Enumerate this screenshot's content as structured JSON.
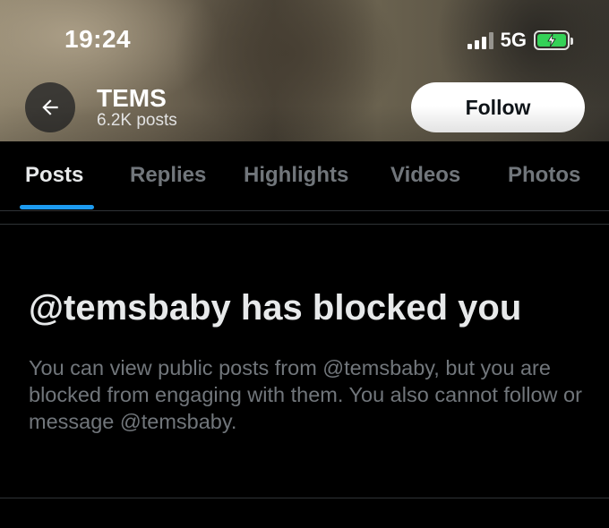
{
  "status_bar": {
    "time": "19:24",
    "network": "5G",
    "icons": [
      "signal-icon",
      "battery-charging-icon"
    ]
  },
  "profile": {
    "name": "TEMS",
    "posts_count": "6.2K posts",
    "follow_label": "Follow",
    "back_icon": "arrow-left-icon"
  },
  "tabs": [
    {
      "label": "Posts",
      "active": true
    },
    {
      "label": "Replies",
      "active": false
    },
    {
      "label": "Highlights",
      "active": false
    },
    {
      "label": "Videos",
      "active": false
    },
    {
      "label": "Photos",
      "active": false
    }
  ],
  "blocked": {
    "title": "@temsbaby has blocked you",
    "description": "You can view public posts from @temsbaby, but you are blocked from engaging with them. You also cannot follow or message @temsbaby."
  },
  "colors": {
    "accent": "#1d9bf0",
    "background": "#000000",
    "text_primary": "#e7e9ea",
    "text_secondary": "#71767b",
    "battery": "#35d157"
  }
}
